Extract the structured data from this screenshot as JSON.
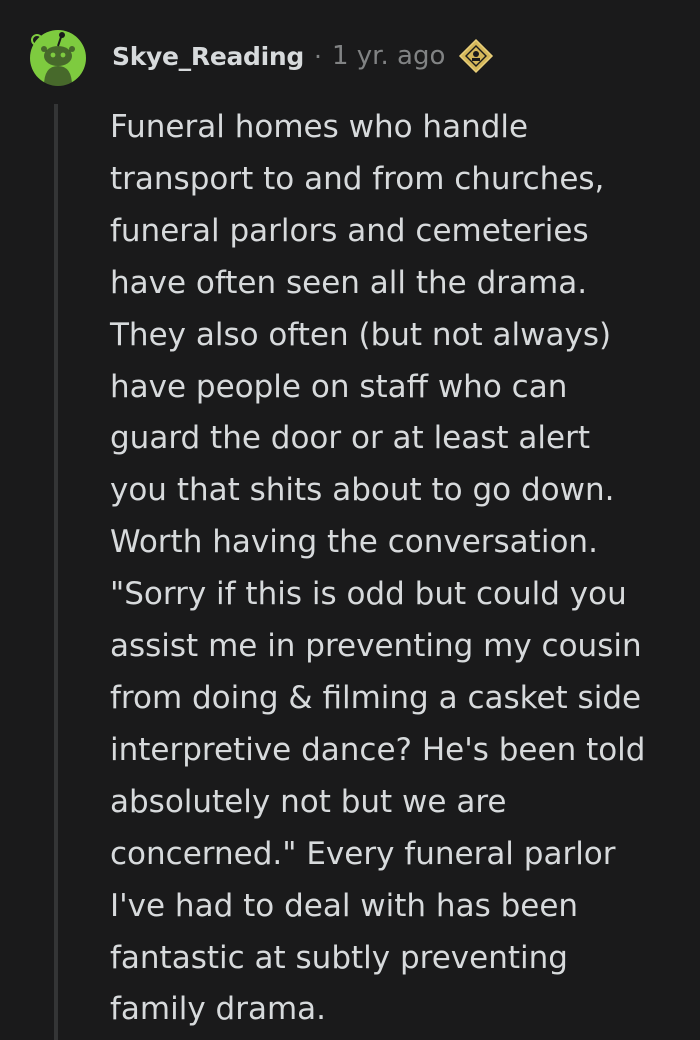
{
  "comment": {
    "author": "Skye_Reading",
    "separator": "·",
    "timestamp": "1 yr. ago",
    "award_icon": "helpful-award-icon",
    "avatar_icon": "snoo-avatar-icon",
    "avatar_color": "#7ecb3f",
    "body_lines": [
      "Funeral homes who handle",
      "transport to and from churches,",
      "funeral parlors and cemeteries",
      "have often seen all the drama.",
      "They also often (but not always)",
      "have people on staff who can",
      "guard the door or at least alert",
      "you that shits about to go down.",
      "Worth having the conversation.",
      "\"Sorry if this is odd but could you",
      "assist me in preventing my cousin",
      "from doing & filming a casket side",
      "interpretive dance? He's been told",
      "absolutely not but we are",
      "concerned.\" Every funeral parlor",
      "I've had to deal with has been",
      "fantastic at subtly preventing",
      "family drama."
    ]
  }
}
